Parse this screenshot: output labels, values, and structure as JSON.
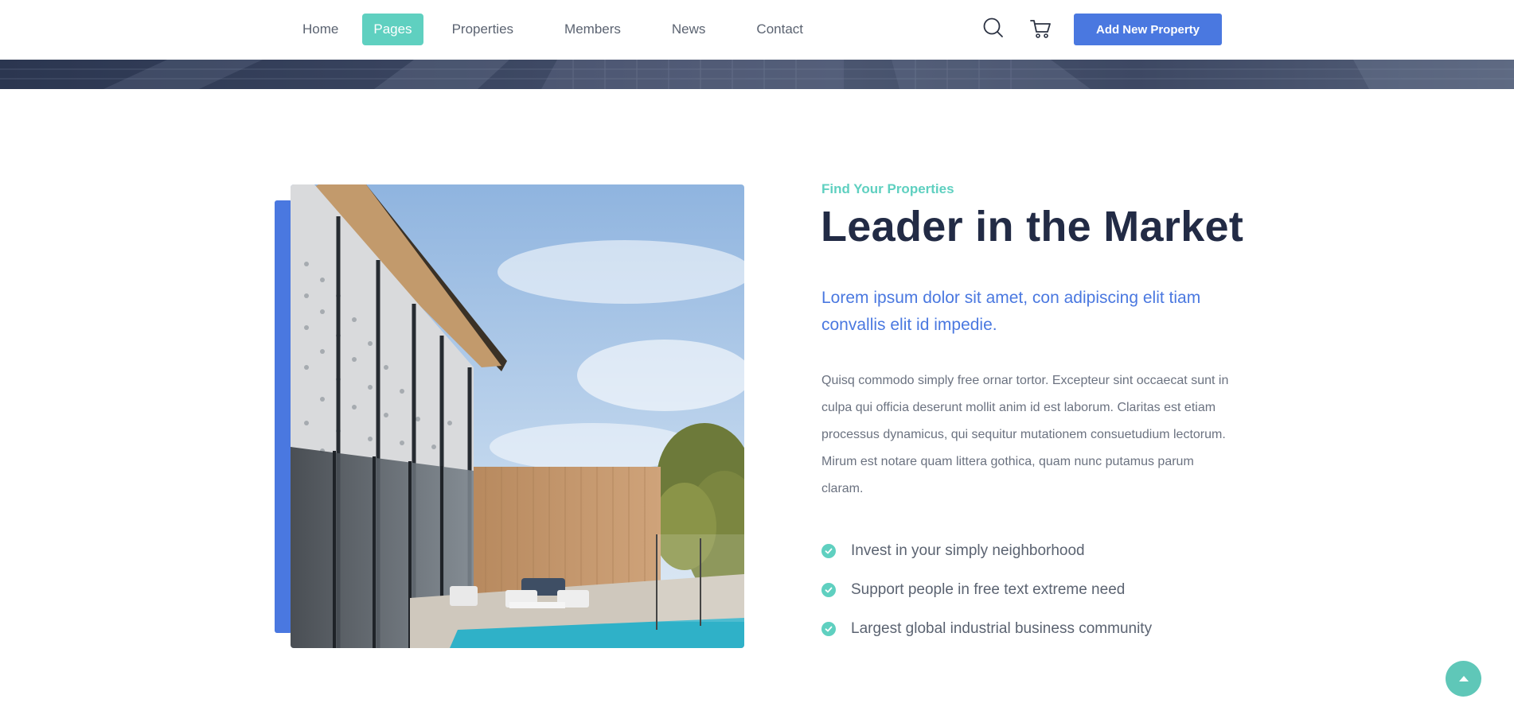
{
  "nav": {
    "items": [
      {
        "label": "Home"
      },
      {
        "label": "Pages"
      },
      {
        "label": "Properties"
      },
      {
        "label": "Members"
      },
      {
        "label": "News"
      },
      {
        "label": "Contact"
      }
    ],
    "active_item": "Pages",
    "icons": [
      "search-icon",
      "cart-icon"
    ],
    "cta_label": "Add New Property"
  },
  "about": {
    "eyebrow": "Find Your Properties",
    "title": "Leader in the Market",
    "lead": "Lorem ipsum dolor sit amet, con adipiscing elit tiam convallis elit id impedie.",
    "body": "Quisq commodo simply free ornar tortor. Excepteur sint occaecat sunt in culpa qui officia deserunt mollit anim id est laborum. Claritas est etiam processus dynamicus, qui sequitur mutationem consuetudium lectorum. Mirum est notare quam littera gothica, quam nunc putamus parum claram.",
    "features": [
      {
        "label": "Invest in your simply neighborhood"
      },
      {
        "label": "Support people in free text extreme need"
      },
      {
        "label": "Largest global industrial business community"
      }
    ]
  },
  "back_to_top_icon": "chevron-up-icon",
  "colors": {
    "primary": "#4a78e0",
    "accent": "#5fd0c0",
    "heading": "#222b45",
    "text": "#6b7280"
  }
}
